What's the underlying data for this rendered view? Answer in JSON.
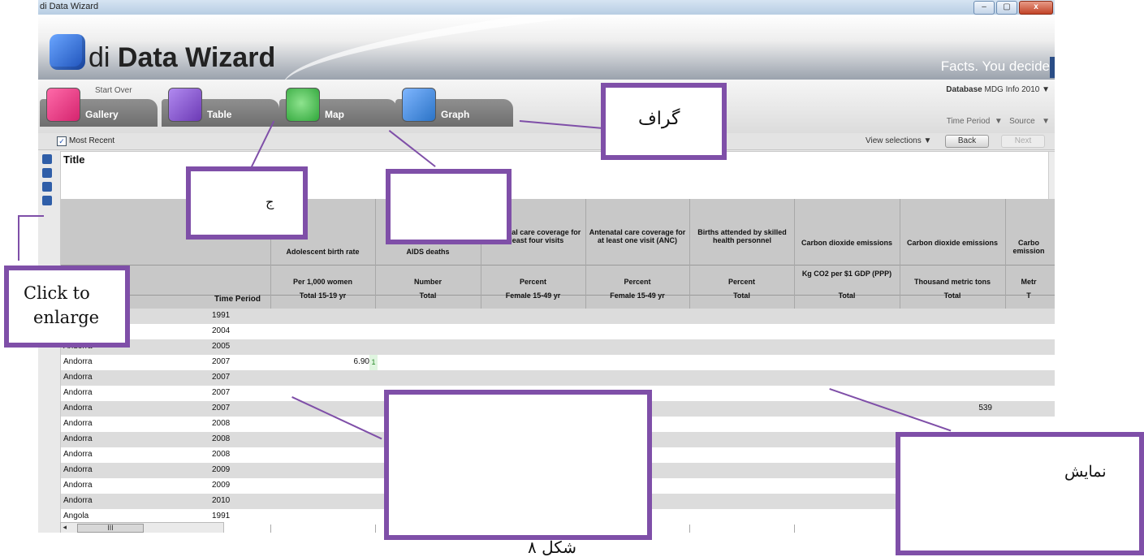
{
  "window": {
    "title": "di Data Wizard",
    "min": "–",
    "max": "▢",
    "close": "x"
  },
  "banner": {
    "app_name_light": "di ",
    "app_name_bold": "Data Wizard",
    "tagline": "Facts. You decide"
  },
  "nav": {
    "start_over": "Start Over",
    "tabs": [
      {
        "label": "Gallery"
      },
      {
        "label": "Table"
      },
      {
        "label": "Map"
      },
      {
        "label": "Graph"
      }
    ],
    "database_label": "Database",
    "database_value": "MDG Info 2010",
    "time_period": "Time Period",
    "source": "Source"
  },
  "toolbar": {
    "most_recent": "Most Recent",
    "checked_mark": "✓",
    "view_selections": "View selections",
    "back": "Back",
    "next": "Next"
  },
  "table": {
    "title": "Title",
    "time_period_header": "Time Period",
    "columns": [
      {
        "indicator": "Adolescent birth rate",
        "unit": "Per 1,000 women",
        "subgroup": "Total 15-19 yr"
      },
      {
        "indicator": "AIDS deaths",
        "unit": "Number",
        "subgroup": "Total"
      },
      {
        "indicator": "Antenatal care coverage for at least four visits",
        "unit": "Percent",
        "subgroup": "Female 15-49 yr"
      },
      {
        "indicator": "Antenatal care coverage for at least one visit (ANC)",
        "unit": "Percent",
        "subgroup": "Female 15-49 yr"
      },
      {
        "indicator": "Births attended by skilled health personnel",
        "unit": "Percent",
        "subgroup": "Total"
      },
      {
        "indicator": "Carbon dioxide emissions",
        "unit": "Kg CO2 per $1 GDP (PPP)",
        "subgroup": "Total"
      },
      {
        "indicator": "Carbon dioxide emissions",
        "unit": "Thousand metric tons",
        "subgroup": "Total"
      },
      {
        "indicator": "Carbo emission",
        "unit": "Metr",
        "subgroup": "T"
      }
    ],
    "rows": [
      {
        "area": "",
        "year": "1991",
        "v1": "",
        "flag": "",
        "v7": ""
      },
      {
        "area": "",
        "year": "2004",
        "v1": "",
        "flag": "",
        "v7": ""
      },
      {
        "area": "Andorra",
        "year": "2005",
        "v1": "",
        "flag": "",
        "v7": ""
      },
      {
        "area": "Andorra",
        "year": "2007",
        "v1": "6.90",
        "flag": "1",
        "v7": ""
      },
      {
        "area": "Andorra",
        "year": "2007",
        "v1": "",
        "flag": "",
        "v7": ""
      },
      {
        "area": "Andorra",
        "year": "2007",
        "v1": "",
        "flag": "",
        "v7": ""
      },
      {
        "area": "Andorra",
        "year": "2007",
        "v1": "",
        "flag": "",
        "v7": "539"
      },
      {
        "area": "Andorra",
        "year": "2008",
        "v1": "",
        "flag": "",
        "v7": ""
      },
      {
        "area": "Andorra",
        "year": "2008",
        "v1": "",
        "flag": "",
        "v7": ""
      },
      {
        "area": "Andorra",
        "year": "2008",
        "v1": "",
        "flag": "",
        "v7": ""
      },
      {
        "area": "Andorra",
        "year": "2009",
        "v1": "",
        "flag": "",
        "v7": ""
      },
      {
        "area": "Andorra",
        "year": "2009",
        "v1": "",
        "flag": "",
        "v7": ""
      },
      {
        "area": "Andorra",
        "year": "2010",
        "v1": "",
        "flag": "",
        "v7": ""
      },
      {
        "area": "Angola",
        "year": "1991",
        "v1": "",
        "flag": "",
        "v7": ""
      }
    ],
    "hscroll_thumb": "III"
  },
  "annotations": {
    "graph": "گراف",
    "map": "ج",
    "enlarge_line1": "Click to",
    "enlarge_line2": "enlarge",
    "display": "نمایش",
    "caption": "شکل ۸"
  },
  "colors": {
    "accent": "#7f4fa8",
    "gallery_icon": "#d4246e",
    "table_icon": "#6c3ab5",
    "map_icon": "#2fa63a",
    "graph_icon": "#2b73c6"
  }
}
